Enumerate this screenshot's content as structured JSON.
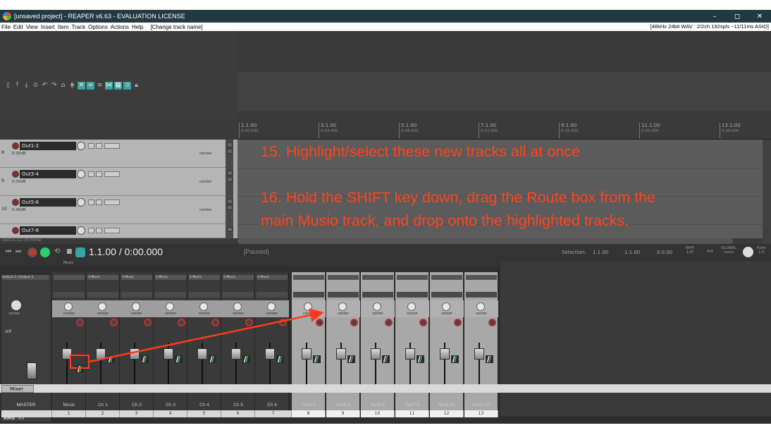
{
  "window": {
    "title": "[unsaved project] - REAPER v6.63 - EVALUATION LICENSE",
    "minimize": "–",
    "maximize": "◻",
    "close": "✕"
  },
  "menu": {
    "items": [
      "File",
      "Edit",
      "View",
      "Insert",
      "Item",
      "Track",
      "Options",
      "Actions",
      "Help"
    ],
    "extra": "[Change track name]",
    "audio_status": "[48kHz 24bit WAV : 2/2ch 192spls ~11/11ms ASIO]"
  },
  "ruler": {
    "marks": [
      {
        "bar": "1.1.00",
        "time": "0:00.000"
      },
      {
        "bar": "3.1.00",
        "time": "0:04.000"
      },
      {
        "bar": "5.1.00",
        "time": "0:08.000"
      },
      {
        "bar": "7.1.00",
        "time": "0:12.000"
      },
      {
        "bar": "9.1.00",
        "time": "0:16.000"
      },
      {
        "bar": "11.1.00",
        "time": "0:20.000"
      },
      {
        "bar": "13.1.00",
        "time": "0:24.000"
      }
    ]
  },
  "tracks": [
    {
      "num": "8",
      "name": "Out1-2",
      "vol": "0.00dB",
      "pan": "center"
    },
    {
      "num": "9",
      "name": "Out3-4",
      "vol": "0.00dB",
      "pan": "center"
    },
    {
      "num": "10",
      "name": "Out5-6",
      "vol": "0.00dB",
      "pan": "center"
    },
    {
      "num": "",
      "name": "Out7-8",
      "vol": "",
      "pan": ""
    }
  ],
  "selection_label": "Out11-12 [0] none",
  "instructions": {
    "step15": "15. Highlight/select these new tracks all at once",
    "step16_line1": "16. Hold the SHIFT key down, drag the Route box from the",
    "step16_line2": "main Musio track, and drop onto the highlighted tracks."
  },
  "transport": {
    "time": "1.1.00 / 0:00.000",
    "status": "[Paused]",
    "selection_label": "Selection:",
    "sel_start": "1.1.00",
    "sel_end": "1.1.00",
    "sel_len": "0.0.00",
    "bpm_label": "BPM",
    "bpm": "120",
    "ts": "4/4",
    "global_label": "GLOBAL",
    "global_val": "none",
    "rate_label": "Rate",
    "rate": "1.0"
  },
  "mixer": {
    "master_route": "Output 1 / Output 2",
    "master_pan": "center",
    "master_rms": "RMS",
    "master_inf": "-inf",
    "master_label": "MASTER",
    "music_header": "Music",
    "strips": [
      {
        "name": "Music",
        "num": "1",
        "route": "",
        "pan": "center",
        "selected": false
      },
      {
        "name": "Ch 1",
        "num": "2",
        "route": "1:Music",
        "pan": "center",
        "selected": false
      },
      {
        "name": "Ch 2",
        "num": "3",
        "route": "1:Music",
        "pan": "center",
        "selected": false
      },
      {
        "name": "Ch 3",
        "num": "4",
        "route": "1:Music",
        "pan": "center",
        "selected": false
      },
      {
        "name": "Ch 4",
        "num": "5",
        "route": "1:Music",
        "pan": "center",
        "selected": false
      },
      {
        "name": "Ch 5",
        "num": "6",
        "route": "1:Music",
        "pan": "center",
        "selected": false
      },
      {
        "name": "Ch 6",
        "num": "7",
        "route": "1:Music",
        "pan": "center",
        "selected": false
      },
      {
        "name": "Out1-2",
        "num": "8",
        "route": "",
        "pan": "center",
        "selected": true
      },
      {
        "name": "Out3-4",
        "num": "9",
        "route": "",
        "pan": "center",
        "selected": true
      },
      {
        "name": "Out5-6",
        "num": "10",
        "route": "",
        "pan": "center",
        "selected": true
      },
      {
        "name": "Out7-8",
        "num": "11",
        "route": "",
        "pan": "center",
        "selected": true
      },
      {
        "name": "Out9-10",
        "num": "12",
        "route": "",
        "pan": "center",
        "selected": true
      },
      {
        "name": "Out11-12",
        "num": "13",
        "route": "",
        "pan": "center",
        "selected": true
      }
    ]
  },
  "dock": {
    "tab": "Mixer"
  },
  "colors": {
    "titlebar": "#203a40",
    "instruction": "#ff4520",
    "accent": "#38a3a0",
    "record": "#c0392b",
    "play": "#2ecc71"
  }
}
